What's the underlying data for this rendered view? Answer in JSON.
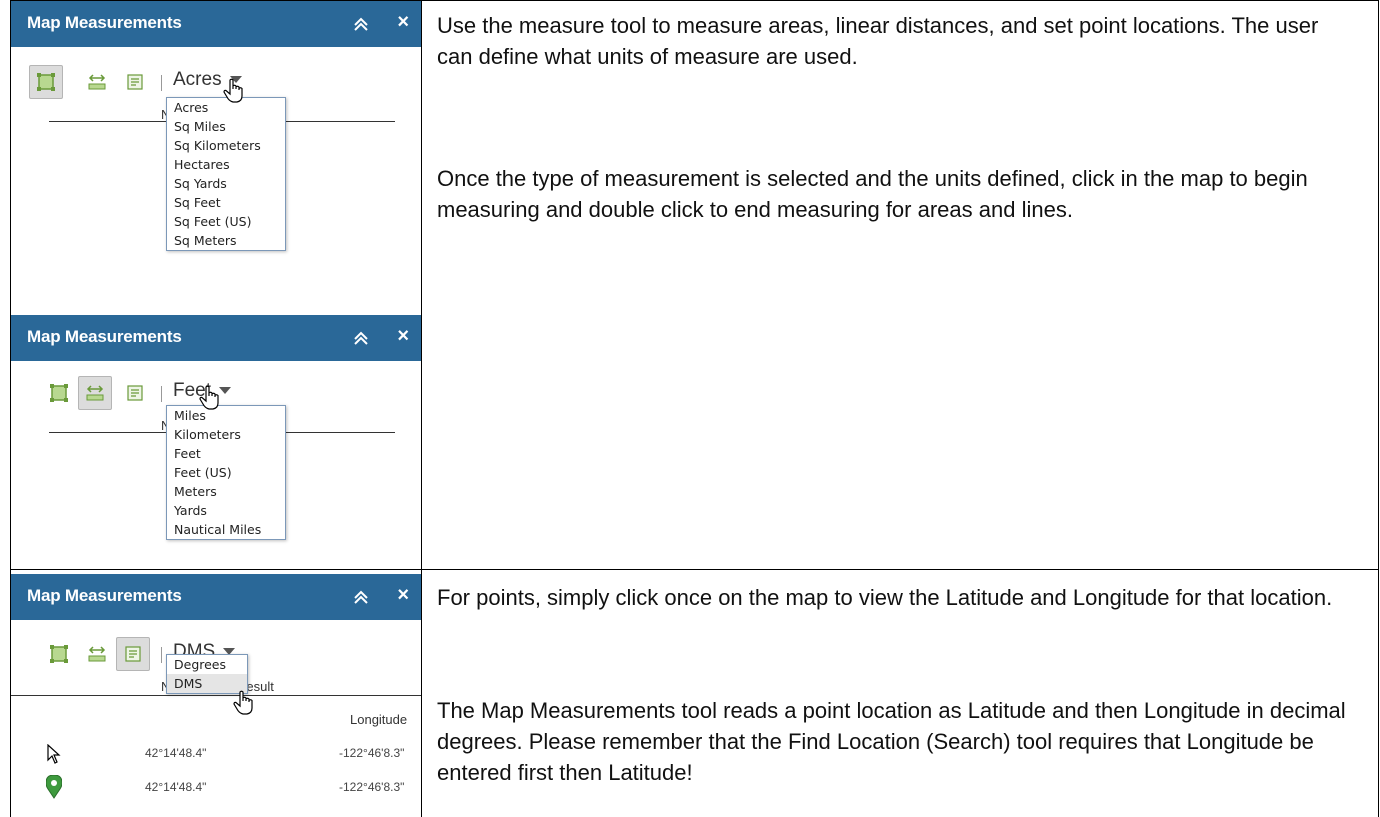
{
  "panels": [
    {
      "title": "Map Measurements",
      "unit": "Acres",
      "options": [
        "Acres",
        "Sq Miles",
        "Sq Kilometers",
        "Hectares",
        "Sq Yards",
        "Sq Feet",
        "Sq Feet (US)",
        "Sq Meters"
      ]
    },
    {
      "title": "Map Measurements",
      "unit": "Feet",
      "options": [
        "Miles",
        "Kilometers",
        "Feet",
        "Feet (US)",
        "Meters",
        "Yards",
        "Nautical Miles"
      ]
    },
    {
      "title": "Map Measurements",
      "unit": "DMS",
      "options": [
        "Degrees",
        "DMS"
      ],
      "result_header": "Result",
      "longitude_header": "Longitude",
      "rows": [
        {
          "icon": "pointer-arrow-icon",
          "lat": "42°14'48.4\"",
          "lon": "-122°46'8.3\""
        },
        {
          "icon": "map-pin-icon",
          "lat": "42°14'48.4\"",
          "lon": "-122°46'8.3\""
        }
      ]
    }
  ],
  "descriptions": {
    "p1": "Use the measure tool to measure areas, linear distances, and set point locations. The user can define what units of measure are used.",
    "p2": "Once the type of measurement is selected and the units defined, click in the map to begin measuring and double click to end measuring for areas and lines.",
    "p3": "For points, simply click once on the map to view the Latitude and Longitude for that location.",
    "p4": "The Map Measurements tool reads a point location as Latitude and then Longitude in decimal degrees. Please remember that the Find Location (Search) tool requires that Longitude be entered first then Latitude!"
  },
  "colors": {
    "header": "#2a6898",
    "tool_green": "#6a9a3a"
  },
  "icons": [
    "area-tool-icon",
    "distance-tool-icon",
    "location-tool-icon",
    "collapse-icon",
    "close-icon",
    "hand-cursor-icon"
  ]
}
